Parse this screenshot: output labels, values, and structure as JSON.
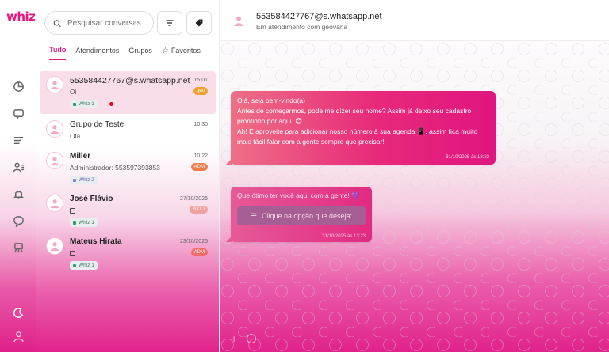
{
  "brand": {
    "logo": "whiz",
    "accent": "#e8157d"
  },
  "rail": {
    "icons": [
      "dashboard-icon",
      "chat-icon",
      "list-icon",
      "contacts-icon",
      "bell-icon",
      "message-icon",
      "broadcast-icon",
      "moon-icon",
      "user-icon"
    ]
  },
  "search": {
    "placeholder": "Pesquisar conversas ..."
  },
  "tabs": [
    {
      "label": "Tudo"
    },
    {
      "label": "Atendimentos"
    },
    {
      "label": "Grupos"
    },
    {
      "label": "Favoritos"
    }
  ],
  "conversations": [
    {
      "name": "553584427767@s.whatsapp.net",
      "preview": "Oi",
      "time": "15:01",
      "badge": "geo",
      "badge_color": "#f0a030",
      "tag": "Whiz 1"
    },
    {
      "name": "Grupo de Teste",
      "preview": "Olá",
      "time": "10:30"
    },
    {
      "name": "Miller",
      "preview": "Administrador: 553597393853",
      "time": "10:22",
      "badge": "ADM",
      "badge_color": "#f07c4a",
      "tag": "Whiz 2"
    },
    {
      "name": "José Flávio",
      "preview": "",
      "time": "27/10/2025",
      "badge": "SKILI",
      "badge_color": "#f0a0a0",
      "tag": "Whiz 1"
    },
    {
      "name": "Mateus Hirata",
      "preview": "",
      "time": "23/10/2025",
      "badge": "ADM",
      "badge_color": "#f06a6a",
      "tag": "Whiz 1"
    }
  ],
  "chat": {
    "title": "553584427767@s.whatsapp.net",
    "subtitle": "Em atendimento com geovana",
    "messages": [
      {
        "lines": [
          "Olá, seja bem-vindo(a)",
          "Antes de começarmos, pode me dizer seu nome? Assim já deixo seu cadastro",
          "prontinho por aqui. 😊",
          "Ah! E aproveite para adicionar nosso número à sua agenda 📱, assim fica muito",
          "mais fácil falar com a gente sempre que precisar!"
        ],
        "timestamp": "31/10/2025 às 13:23"
      },
      {
        "lines": [
          "Que ótimo ter você aqui com a gente! 💜"
        ],
        "button": "Clique na opção que deseja:",
        "timestamp": "31/10/2025 às 13:23"
      }
    ]
  }
}
